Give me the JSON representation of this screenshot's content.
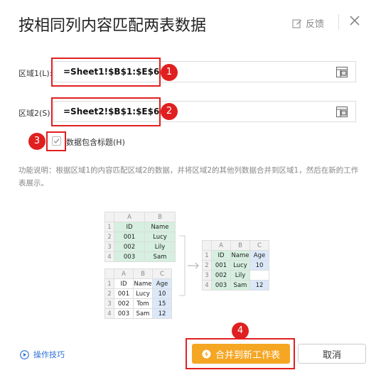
{
  "dialog": {
    "title": "按相同列内容匹配两表数据",
    "feedback_label": "反馈"
  },
  "range1": {
    "label": "区域1(L):",
    "value": "=Sheet1!$B$1:$E$6"
  },
  "range2": {
    "label": "区域2(S):",
    "value": "=Sheet2!$B$1:$E$6"
  },
  "header_checkbox": {
    "label": "数据包含标题(H)",
    "checked": true
  },
  "description": "功能说明：根据区域1的内容匹配区域2的数据，并将区域2的其他列数据合并到区域1，然后在新的工作表展示。",
  "markers": [
    "1",
    "2",
    "3",
    "4"
  ],
  "illustration": {
    "table1": {
      "cols": [
        "A",
        "B"
      ],
      "rows": [
        {
          "num": "1",
          "cells": [
            "ID",
            "Name"
          ]
        },
        {
          "num": "2",
          "cells": [
            "001",
            "Lucy"
          ]
        },
        {
          "num": "3",
          "cells": [
            "002",
            "Lily"
          ]
        },
        {
          "num": "4",
          "cells": [
            "003",
            "Sam"
          ]
        }
      ]
    },
    "table2": {
      "cols": [
        "A",
        "B",
        "C"
      ],
      "rows": [
        {
          "num": "1",
          "cells": [
            "ID",
            "Name",
            "Age"
          ]
        },
        {
          "num": "2",
          "cells": [
            "001",
            "Lucy",
            "10"
          ]
        },
        {
          "num": "3",
          "cells": [
            "002",
            "Tom",
            "15"
          ]
        },
        {
          "num": "4",
          "cells": [
            "003",
            "Sam",
            "12"
          ]
        }
      ]
    },
    "result": {
      "cols": [
        "A",
        "B",
        "C"
      ],
      "rows": [
        {
          "num": "1",
          "cells": [
            "ID",
            "Name",
            "Age"
          ]
        },
        {
          "num": "2",
          "cells": [
            "001",
            "Lucy",
            "10"
          ]
        },
        {
          "num": "3",
          "cells": [
            "002",
            "Lily",
            ""
          ]
        },
        {
          "num": "4",
          "cells": [
            "003",
            "Sam",
            "12"
          ]
        }
      ]
    }
  },
  "footer": {
    "tips_label": "操作技巧",
    "merge_button": "合并到新工作表",
    "cancel_button": "取消"
  },
  "colors": {
    "accent": "#f5a623",
    "marker_red": "#e02020",
    "link_blue": "#2b6fd6"
  }
}
